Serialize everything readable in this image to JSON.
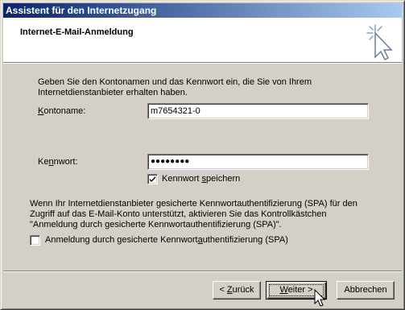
{
  "window": {
    "title": "Assistent für den Internetzugang"
  },
  "header": {
    "title": "Internet-E-Mail-Anmeldung",
    "icon": "wizard-wand-icon"
  },
  "intro": {
    "line1": "Geben Sie den Kontonamen und das Kennwort ein, die Sie von Ihrem",
    "line2": "Internetdienstanbieter erhalten haben."
  },
  "account": {
    "label_pre": "",
    "label_u": "K",
    "label_post": "ontoname:",
    "value": "m7654321-0"
  },
  "password": {
    "label_pre": "Ke",
    "label_u": "n",
    "label_post": "nwort:",
    "value": "●●●●●●●●",
    "save_label_pre": "Kennwort ",
    "save_label_u": "s",
    "save_label_post": "peichern",
    "save_checked": true
  },
  "spa_info": {
    "line1": "Wenn Ihr Internetdienstanbieter gesicherte Kennwortauthentifizierung (SPA) für den",
    "line2": "Zugriff auf das E-Mail-Konto unterstützt, aktivieren Sie das Kontrollkästchen",
    "line3": "\"Anmeldung durch gesicherte Kennwortauthentifizierung (SPA)\".",
    "checkbox_pre": "Anmeldung durch gesicherte Kennwort",
    "checkbox_u": "a",
    "checkbox_post": "uthentifizierung (SPA)",
    "checkbox_checked": false
  },
  "buttons": {
    "back_pre": "< ",
    "back_u": "Z",
    "back_post": "urück",
    "next_u": "W",
    "next_post": "eiter >",
    "cancel": "Abbrechen"
  }
}
